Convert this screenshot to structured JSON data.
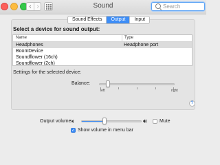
{
  "window": {
    "title": "Sound"
  },
  "search": {
    "placeholder": "Search",
    "value": ""
  },
  "tabs": [
    {
      "label": "Sound Effects",
      "active": false
    },
    {
      "label": "Output",
      "active": true
    },
    {
      "label": "Input",
      "active": false
    }
  ],
  "output": {
    "heading": "Select a device for sound output:",
    "columns": [
      "Name",
      "Type"
    ],
    "devices": [
      {
        "name": "Headphones",
        "type": "Headphone port",
        "selected": true
      },
      {
        "name": "BoomDevice",
        "type": "",
        "selected": false
      },
      {
        "name": "Soundflower (16ch)",
        "type": "",
        "selected": false
      },
      {
        "name": "Soundflower (2ch)",
        "type": "",
        "selected": false
      }
    ],
    "settings_label": "Settings for the selected device:",
    "balance": {
      "label": "Balance:",
      "left_label": "left",
      "right_label": "right",
      "value": 0.1
    }
  },
  "footer": {
    "volume_label": "Output volume:",
    "volume_value": 0.38,
    "mute_label": "Mute",
    "mute_checked": false,
    "menubar_label": "Show volume in menu bar",
    "menubar_checked": true
  },
  "icons": {
    "speaker_low": "speaker-low-icon",
    "speaker_high": "speaker-high-icon",
    "help": "help-icon",
    "search": "search-icon"
  },
  "colors": {
    "accent": "#3d8df6"
  }
}
